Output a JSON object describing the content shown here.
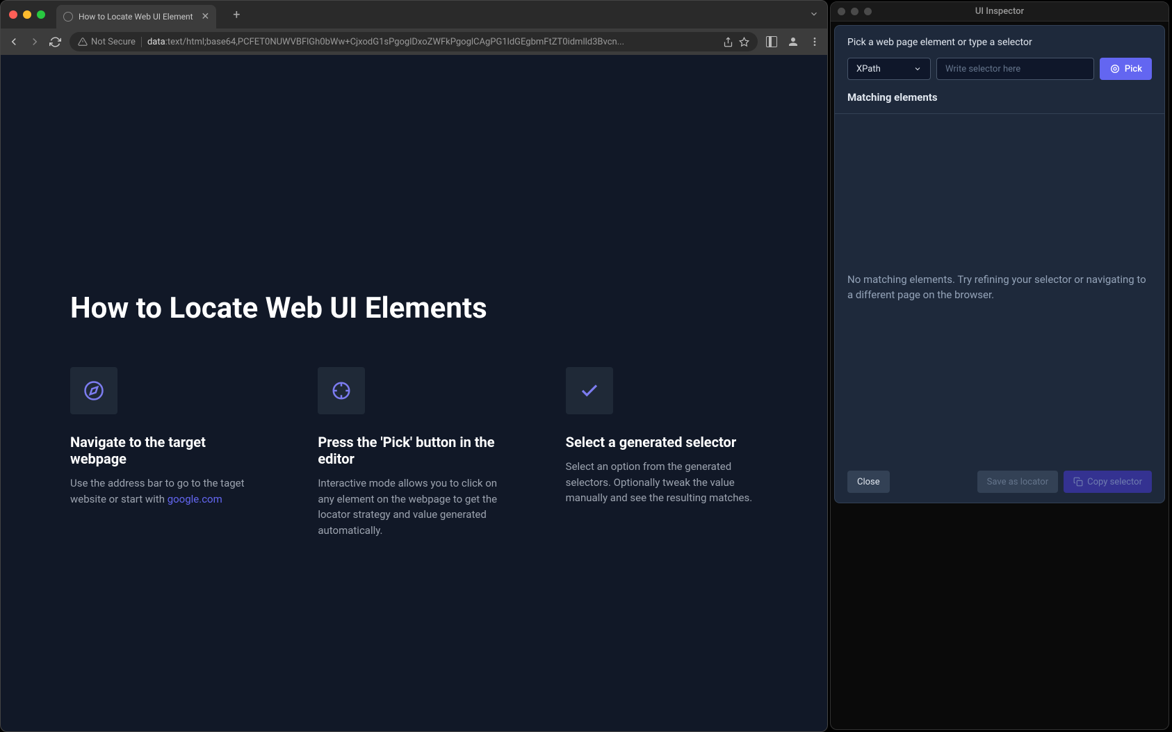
{
  "browser": {
    "tab_title": "How to Locate Web UI Element",
    "security_label": "Not Secure",
    "url_prefix": "data",
    "url_rest": ":text/html;base64,PCFET0NUWVBFlGh0bWw+CjxodG1sPgoglDxoZWFkPgoglCAgPG1ldGEgbmFtZT0idmlld3Bvcn...",
    "page": {
      "title": "How to Locate Web UI Elements",
      "steps": [
        {
          "icon": "compass",
          "title": "Navigate to the target webpage",
          "desc_pre": "Use the address bar to go to the taget website or start with ",
          "link_text": "google.com"
        },
        {
          "icon": "crosshair",
          "title": "Press the 'Pick' button in the editor",
          "desc": "Interactive mode allows you to click on any element on the webpage to get the locator strategy and value generated automatically."
        },
        {
          "icon": "check",
          "title": "Select a generated selector",
          "desc": "Select an option from the generated selectors. Optionally tweak the value manually and see the resulting matches."
        }
      ]
    }
  },
  "inspector": {
    "window_title": "UI Inspector",
    "prompt": "Pick a web page element or type a selector",
    "selector_type": "XPath",
    "input_placeholder": "Write selector here",
    "pick_label": "Pick",
    "matching_header": "Matching elements",
    "no_match_msg": "No matching elements. Try refining your selector or navigating to a different page on the browser.",
    "buttons": {
      "close": "Close",
      "save": "Save as locator",
      "copy": "Copy selector"
    }
  }
}
